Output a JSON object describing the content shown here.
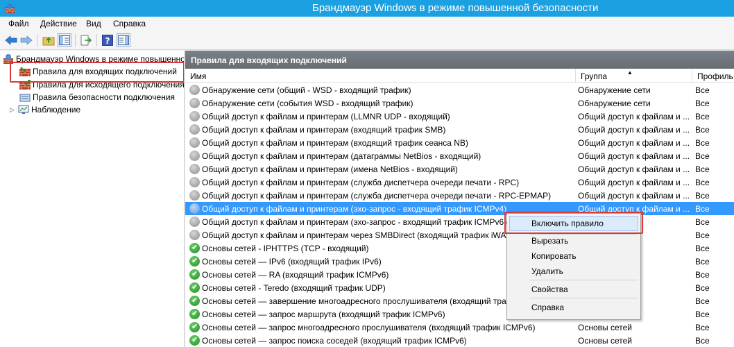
{
  "window": {
    "title": "Брандмауэр Windows в режиме повышенной безопасности"
  },
  "menu": [
    "Файл",
    "Действие",
    "Вид",
    "Справка"
  ],
  "toolbar": {
    "buttons": [
      "back-arrow-icon",
      "forward-arrow-icon",
      "up-folder-icon",
      "show-hide-tree-icon",
      "export-list-icon",
      "help-icon",
      "properties-pane-icon"
    ]
  },
  "tree": {
    "root": "Брандмауэр Windows в режиме повышенной безопасности",
    "items": [
      "Правила для входящих подключений",
      "Правила для исходящего подключения",
      "Правила безопасности подключения",
      "Наблюдение"
    ]
  },
  "list": {
    "header": "Правила для входящих подключений",
    "columns": {
      "name": "Имя",
      "group": "Группа",
      "profile": "Профиль"
    },
    "rows": [
      {
        "name": "Обнаружение сети (общий - WSD - входящий трафик)",
        "group": "Обнаружение сети",
        "profile": "Все",
        "enabled": false
      },
      {
        "name": "Обнаружение сети (события WSD - входящий трафик)",
        "group": "Обнаружение сети",
        "profile": "Все",
        "enabled": false
      },
      {
        "name": "Общий доступ к файлам и принтерам (LLMNR UDP - входящий)",
        "group": "Общий доступ к файлам и ...",
        "profile": "Все",
        "enabled": false
      },
      {
        "name": "Общий доступ к файлам и принтерам (входящий трафик SMB)",
        "group": "Общий доступ к файлам и ...",
        "profile": "Все",
        "enabled": false
      },
      {
        "name": "Общий доступ к файлам и принтерам (входящий трафик сеанса NB)",
        "group": "Общий доступ к файлам и ...",
        "profile": "Все",
        "enabled": false
      },
      {
        "name": "Общий доступ к файлам и принтерам (датаграммы NetBios - входящий)",
        "group": "Общий доступ к файлам и ...",
        "profile": "Все",
        "enabled": false
      },
      {
        "name": "Общий доступ к файлам и принтерам (имена NetBios - входящий)",
        "group": "Общий доступ к файлам и ...",
        "profile": "Все",
        "enabled": false
      },
      {
        "name": "Общий доступ к файлам и принтерам (служба диспетчера очереди печати - RPC)",
        "group": "Общий доступ к файлам и ...",
        "profile": "Все",
        "enabled": false
      },
      {
        "name": "Общий доступ к файлам и принтерам (служба диспетчера очереди печати - RPC-EPMAP)",
        "group": "Общий доступ к файлам и ...",
        "profile": "Все",
        "enabled": false
      },
      {
        "name": "Общий доступ к файлам и принтерам (эхо-запрос - входящий трафик ICMPv4)",
        "group": "Общий доступ к файлам и ...",
        "profile": "Все",
        "enabled": false,
        "selected": true
      },
      {
        "name": "Общий доступ к файлам и принтерам (эхо-запрос - входящий трафик ICMPv6)",
        "group": "",
        "profile": "Все",
        "enabled": false
      },
      {
        "name": "Общий доступ к файлам и принтерам через SMBDirect (входящий трафик iWARP)",
        "group": "",
        "profile": "Все",
        "enabled": false
      },
      {
        "name": "Основы сетей - IPHTTPS (TCP - входящий)",
        "group": "",
        "profile": "Все",
        "enabled": true
      },
      {
        "name": "Основы сетей — IPv6 (входящий трафик IPv6)",
        "group": "",
        "profile": "Все",
        "enabled": true
      },
      {
        "name": "Основы сетей — RA (входящий трафик ICMPv6)",
        "group": "",
        "profile": "Все",
        "enabled": true
      },
      {
        "name": "Основы сетей - Teredo (входящий трафик UDP)",
        "group": "",
        "profile": "Все",
        "enabled": true
      },
      {
        "name": "Основы сетей — завершение многоадресного прослушивателя (входящий трафик ICMPv6)",
        "group": "",
        "profile": "Все",
        "enabled": true
      },
      {
        "name": "Основы сетей — запрос маршрута (входящий трафик ICMPv6)",
        "group": "",
        "profile": "Все",
        "enabled": true
      },
      {
        "name": "Основы сетей — запрос многоадресного прослушивателя (входящий трафик ICMPv6)",
        "group": "Основы сетей",
        "profile": "Все",
        "enabled": true
      },
      {
        "name": "Основы сетей — запрос поиска соседей (входящий трафик ICMPv6)",
        "group": "Основы сетей",
        "profile": "Все",
        "enabled": true
      }
    ]
  },
  "context_menu": [
    "Включить правило",
    "Вырезать",
    "Копировать",
    "Удалить",
    "Свойства",
    "Справка"
  ],
  "colors": {
    "title_bar": "#1ba1e2",
    "selection": "#3399ff",
    "highlight_border": "#d83a3a"
  }
}
